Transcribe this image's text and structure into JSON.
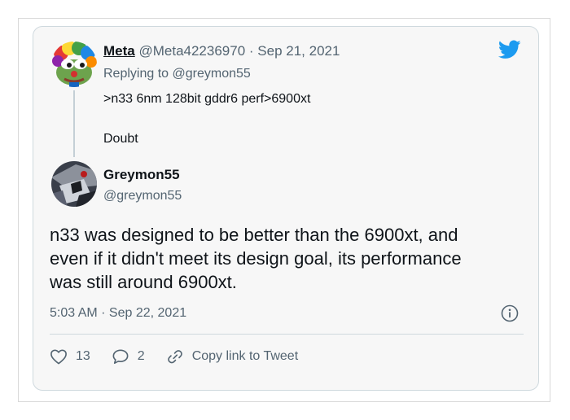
{
  "reply_to_tweet": {
    "author_name": "Meta",
    "author_handle": "@Meta42236970",
    "separator": "·",
    "date": "Sep 21, 2021",
    "replying_to": "Replying to @greymon55",
    "text_line1": ">n33 6nm 128bit gddr6 perf>6900xt",
    "text_line2": "Doubt"
  },
  "main_tweet": {
    "author_name": "Greymon55",
    "author_handle": "@greymon55",
    "text_lines": [
      "n33 was designed to be better than the 6900xt, and",
      "even if it didn't meet its design goal, its performance",
      "was still around 6900xt."
    ],
    "timestamp": "5:03 AM · Sep 22, 2021"
  },
  "actions": {
    "likes": "13",
    "replies": "2",
    "copy_link": "Copy link to Tweet"
  },
  "icons": {
    "brand": "twitter-bird-icon",
    "info": "info-icon",
    "like": "heart-icon",
    "reply": "speech-bubble-icon",
    "link": "link-icon"
  },
  "colors": {
    "brand_blue": "#1d9bf0",
    "secondary_text": "#536471",
    "primary_text": "#0f1419"
  }
}
